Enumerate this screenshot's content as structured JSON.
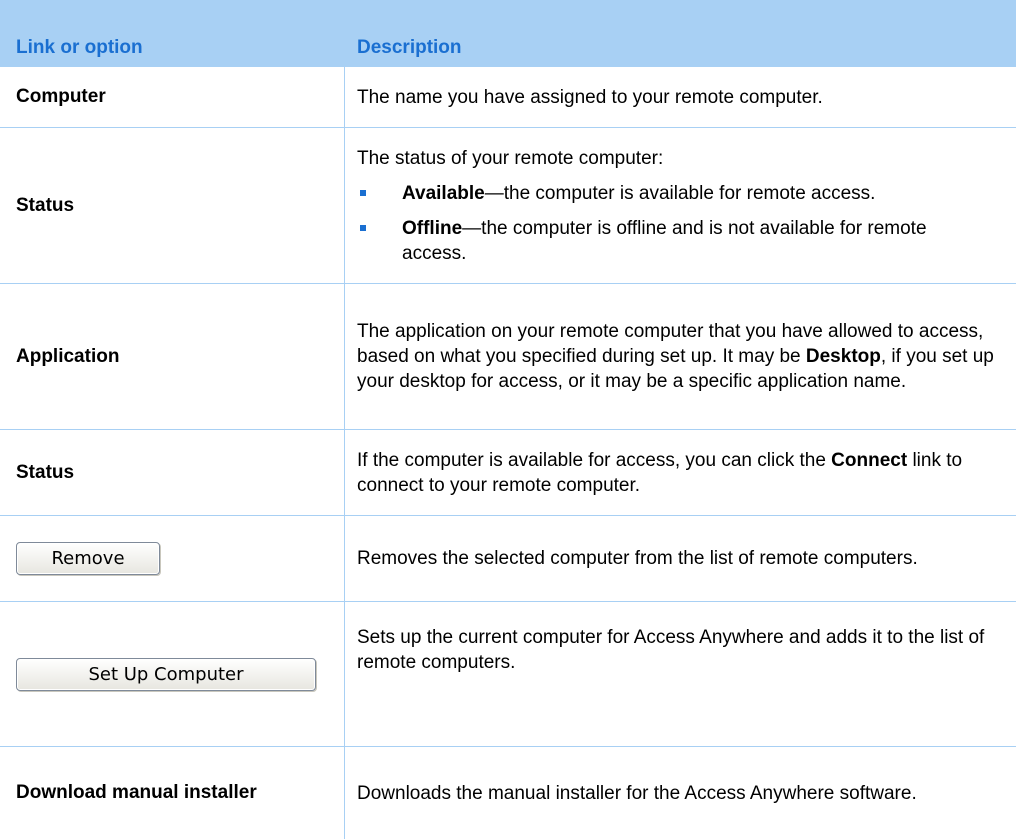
{
  "header": {
    "col1": "Link or option",
    "col2": "Description"
  },
  "rows": [
    {
      "name": "Computer",
      "description": "The name you have assigned to your remote computer."
    },
    {
      "name": "Status",
      "intro": "The status of your remote computer:",
      "bullets": [
        {
          "term": "Available",
          "text": "—the computer is available for remote access."
        },
        {
          "term": "Offline",
          "text": "—the computer is offline and is not available for remote access."
        }
      ]
    },
    {
      "name": "Application",
      "description_part1": "The application on your remote computer that you have allowed to access, based on what you specified during set up. It may be ",
      "description_bold": "Desktop",
      "description_part2": ", if you set up your desktop for access, or it may be a specific application name."
    },
    {
      "name": "Status",
      "description_part1": "If the computer is available for access, you can click the ",
      "description_bold": "Connect",
      "description_part2": " link to connect to your remote computer."
    },
    {
      "button_label": "Remove",
      "description": "Removes the selected computer from the list of remote computers."
    },
    {
      "button_label": "Set Up Computer",
      "description": "Sets up the current computer for Access Anywhere and adds it to the list of remote computers."
    },
    {
      "name": "Download manual installer",
      "description": "Downloads the manual installer for the Access Anywhere software."
    }
  ],
  "colors": {
    "header_background": "#a8d0f4",
    "header_text": "#1a6fd1",
    "bullet": "#1a6fd1",
    "grid_lines": "#a8d0f4"
  }
}
